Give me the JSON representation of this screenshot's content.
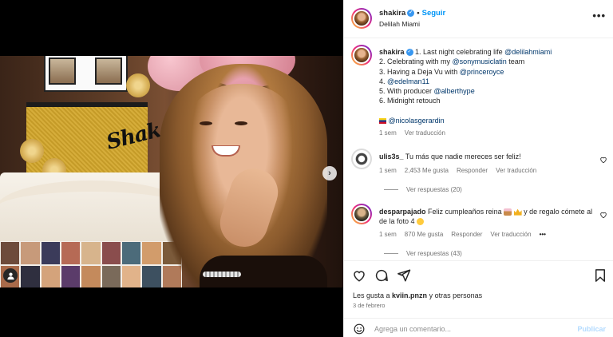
{
  "post": {
    "username": "shakira",
    "follow_label": "Seguir",
    "location": "Delilah Miami",
    "more_label": "•••"
  },
  "caption": {
    "username": "shakira",
    "lines": [
      {
        "prefix": "1. Last night celebrating life ",
        "mention": "@delilahmiami"
      },
      {
        "prefix": "2. Celebrating with my ",
        "mention": "@sonymusiclatin",
        "suffix": " team"
      },
      {
        "prefix": "3. Having a Deja Vu with ",
        "mention": "@princeroyce"
      },
      {
        "prefix": "4. ",
        "mention": "@edelman11"
      },
      {
        "prefix": "5. With producer ",
        "mention": "@alberthype"
      },
      {
        "prefix": "6. Midnight retouch",
        "mention": ""
      }
    ],
    "credit_mention": "@nicolasgerardin",
    "time": "1 sem",
    "translation": "Ver traducción"
  },
  "comments": [
    {
      "username": "ulis3s_",
      "text": "Tu más que nadie mereces ser feliz!",
      "time": "1 sem",
      "likes": "2,453 Me gusta",
      "reply": "Responder",
      "translation": "Ver traducción",
      "replies": "Ver respuestas (20)"
    },
    {
      "username": "desparpajado",
      "text_a": "Feliz cumpleaños reina ",
      "text_b": " y de regalo cómete al de la foto 4 ",
      "time": "1 sem",
      "likes": "870 Me gusta",
      "reply": "Responder",
      "translation": "Ver traducción",
      "more": "•••",
      "replies": "Ver respuestas (43)"
    }
  ],
  "footer": {
    "likes_prefix": "Les gusta a ",
    "likes_user": "kviin.pnzn",
    "likes_suffix": " y otras personas",
    "date": "3 de febrero",
    "comment_placeholder": "Agrega un comentario...",
    "publish_label": "Publicar"
  },
  "colors": {
    "link": "#0095f6",
    "mention": "#00376b",
    "muted": "#737373",
    "verified": "#3897f0"
  },
  "icons": [
    "heart-icon",
    "comment-icon",
    "share-icon",
    "bookmark-icon",
    "emoji-icon",
    "verified-icon",
    "next-arrow-icon",
    "user-tag-icon"
  ]
}
